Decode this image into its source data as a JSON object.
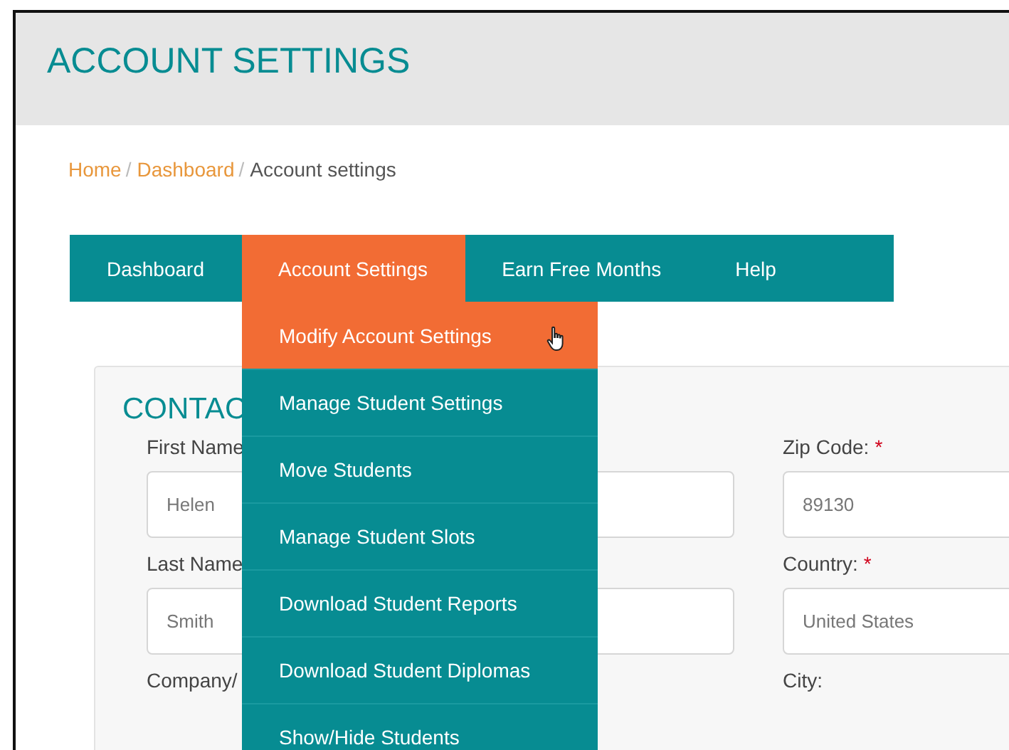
{
  "page_title": "ACCOUNT SETTINGS",
  "breadcrumb": {
    "separator": "/",
    "items": [
      {
        "label": "Home",
        "kind": "link"
      },
      {
        "label": "Dashboard",
        "kind": "link"
      },
      {
        "label": "Account settings",
        "kind": "current"
      }
    ]
  },
  "nav": {
    "tabs": [
      {
        "label": "Dashboard",
        "selected": false
      },
      {
        "label": "Account Settings",
        "selected": true
      },
      {
        "label": "Earn Free Months",
        "selected": false
      },
      {
        "label": "Help",
        "selected": false
      }
    ],
    "dropdown": [
      {
        "label": "Modify Account Settings",
        "selected": true
      },
      {
        "label": "Manage Student Settings",
        "selected": false
      },
      {
        "label": "Move Students",
        "selected": false
      },
      {
        "label": "Manage Student Slots",
        "selected": false
      },
      {
        "label": "Download Student Reports",
        "selected": false
      },
      {
        "label": "Download Student Diplomas",
        "selected": false
      },
      {
        "label": "Show/Hide Students",
        "selected": false
      }
    ]
  },
  "contact": {
    "title": "CONTAC",
    "rows": [
      [
        {
          "label": "First Name",
          "value": "Helen"
        },
        {
          "label": "Zip Code:",
          "marker": "*",
          "value": "89130"
        }
      ],
      [
        {
          "label": "Last Name",
          "value": "Smith"
        },
        {
          "label": "Country:",
          "marker": "*",
          "value": "United States"
        }
      ],
      [
        {
          "label": "Company/"
        },
        {
          "label": "City:"
        }
      ]
    ]
  }
}
